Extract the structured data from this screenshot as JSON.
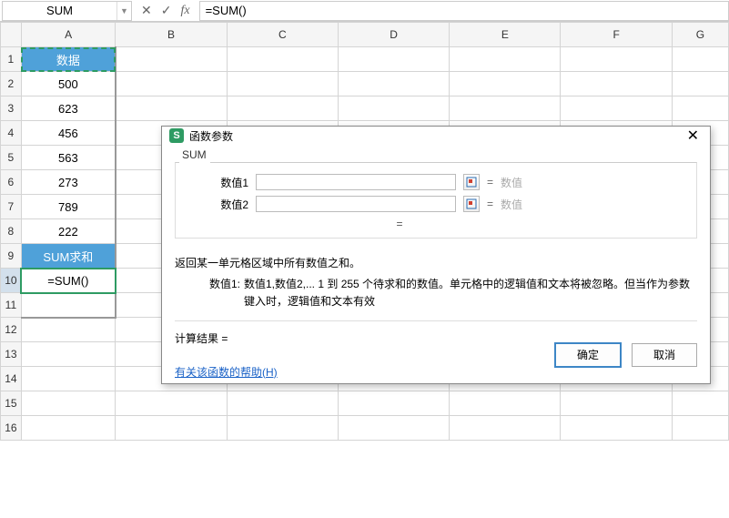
{
  "formula_bar": {
    "name_box": "SUM",
    "formula": "=SUM()",
    "cancel_icon": "✕",
    "confirm_icon": "✓",
    "fx_icon": "fx"
  },
  "sheet": {
    "columns": [
      "A",
      "B",
      "C",
      "D",
      "E",
      "F",
      "G"
    ],
    "rows": [
      "1",
      "2",
      "3",
      "4",
      "5",
      "6",
      "7",
      "8",
      "9",
      "10",
      "11",
      "12",
      "13",
      "14",
      "15",
      "16"
    ],
    "cells": {
      "A1": "数据",
      "A2": "500",
      "A3": "623",
      "A4": "456",
      "A5": "563",
      "A6": "273",
      "A7": "789",
      "A8": "222",
      "A9": "SUM求和",
      "A10": "=SUM()"
    },
    "active_cell": "A10"
  },
  "dialog": {
    "title": "函数参数",
    "func_name": "SUM",
    "args": [
      {
        "label": "数值1",
        "value": "",
        "result_hint": "数值"
      },
      {
        "label": "数值2",
        "value": "",
        "result_hint": "数值"
      }
    ],
    "overall_eq": "=",
    "description": "返回某一单元格区域中所有数值之和。",
    "param_label": "数值1:",
    "param_desc": "数值1,数值2,... 1 到 255 个待求和的数值。单元格中的逻辑值和文本将被忽略。但当作为参数键入时，逻辑值和文本有效",
    "calc_label": "计算结果 =",
    "calc_value": "",
    "help_link": "有关该函数的帮助(H)",
    "ok_btn": "确定",
    "cancel_btn": "取消"
  }
}
